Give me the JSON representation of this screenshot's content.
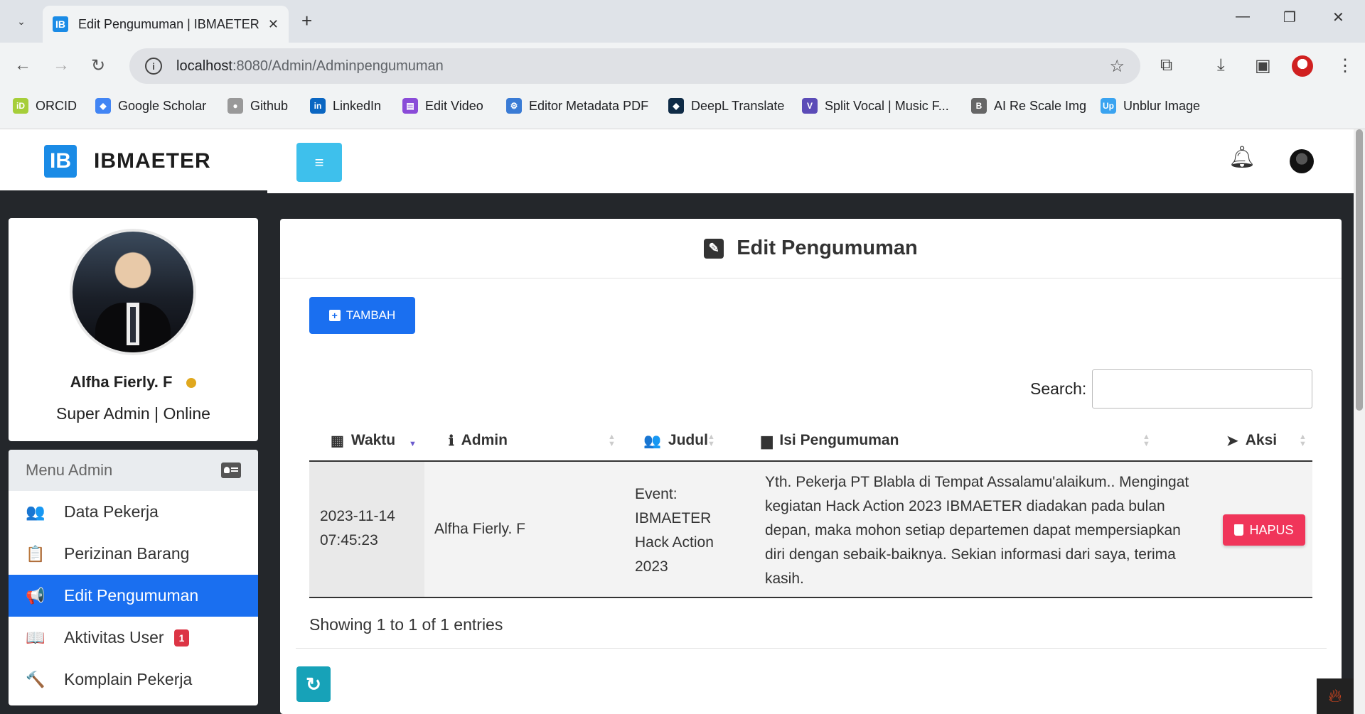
{
  "browser": {
    "tab_title": "Edit Pengumuman | IBMAETER",
    "tab_favicon": "IB",
    "url_host": "localhost",
    "url_path": ":8080/Admin/Adminpengumuman",
    "bookmarks": [
      {
        "label": "ORCID",
        "color": "#a6ce39",
        "icon": "iD"
      },
      {
        "label": "Google Scholar",
        "color": "#4285f4",
        "icon": "◆"
      },
      {
        "label": "Github",
        "color": "#999999",
        "icon": "●"
      },
      {
        "label": "LinkedIn",
        "color": "#0a66c2",
        "icon": "in"
      },
      {
        "label": "Edit Video",
        "color": "#8a4bd8",
        "icon": "▤"
      },
      {
        "label": "Editor Metadata PDF",
        "color": "#3a7bd5",
        "icon": "⚙"
      },
      {
        "label": "DeepL Translate",
        "color": "#0f2b46",
        "icon": "◆"
      },
      {
        "label": "Split Vocal | Music F...",
        "color": "#5b4bb7",
        "icon": "V"
      },
      {
        "label": "AI Re Scale Img",
        "color": "#666666",
        "icon": "B"
      },
      {
        "label": "Unblur Image",
        "color": "#3aa3f0",
        "icon": "Up"
      }
    ]
  },
  "app": {
    "logo_text": "IB",
    "brand": "IBMAETER",
    "accent": "#1a6ff0"
  },
  "profile": {
    "name": "Alfha Fierly. F",
    "role": "Super Admin | Online",
    "status_color": "#e0a81e"
  },
  "menu": {
    "title": "Menu Admin",
    "items": [
      {
        "label": "Data Pekerja",
        "icon": "users-icon",
        "glyph": "👥",
        "active": false
      },
      {
        "label": "Perizinan Barang",
        "icon": "clipboard-icon",
        "glyph": "📋",
        "active": false
      },
      {
        "label": "Edit Pengumuman",
        "icon": "megaphone-icon",
        "glyph": "📢",
        "active": true
      },
      {
        "label": "Aktivitas User",
        "icon": "book-reader-icon",
        "glyph": "📖",
        "active": false,
        "badge": "1"
      },
      {
        "label": "Komplain Pekerja",
        "icon": "gavel-icon",
        "glyph": "🔨",
        "active": false
      }
    ]
  },
  "content": {
    "title": "Edit Pengumuman",
    "add_button": "TAMBAH",
    "search_label": "Search:",
    "search_value": "",
    "columns": [
      {
        "label": "Waktu",
        "icon": "calendar-icon"
      },
      {
        "label": "Admin",
        "icon": "info-icon"
      },
      {
        "label": "Judul",
        "icon": "users-icon"
      },
      {
        "label": "Isi Pengumuman",
        "icon": "box-icon"
      },
      {
        "label": "Aksi",
        "icon": "send-icon"
      }
    ],
    "rows": [
      {
        "waktu_date": "2023-11-14",
        "waktu_time": "07:45:23",
        "admin": "Alfha Fierly. F",
        "judul_lines": [
          "Event:",
          "IBMAETER",
          "Hack Action",
          "2023"
        ],
        "isi_lines": [
          "Yth. Pekerja PT Blabla di Tempat Assalamu'alaikum.. Mengingat",
          "kegiatan Hack Action 2023 IBMAETER diadakan pada bulan",
          "depan, maka mohon setiap departemen dapat mempersiapkan",
          "diri dengan sebaik-baiknya. Sekian informasi dari saya, terima",
          "kasih."
        ],
        "action": "HAPUS"
      }
    ],
    "info": "Showing 1 to 1 of 1 entries"
  }
}
